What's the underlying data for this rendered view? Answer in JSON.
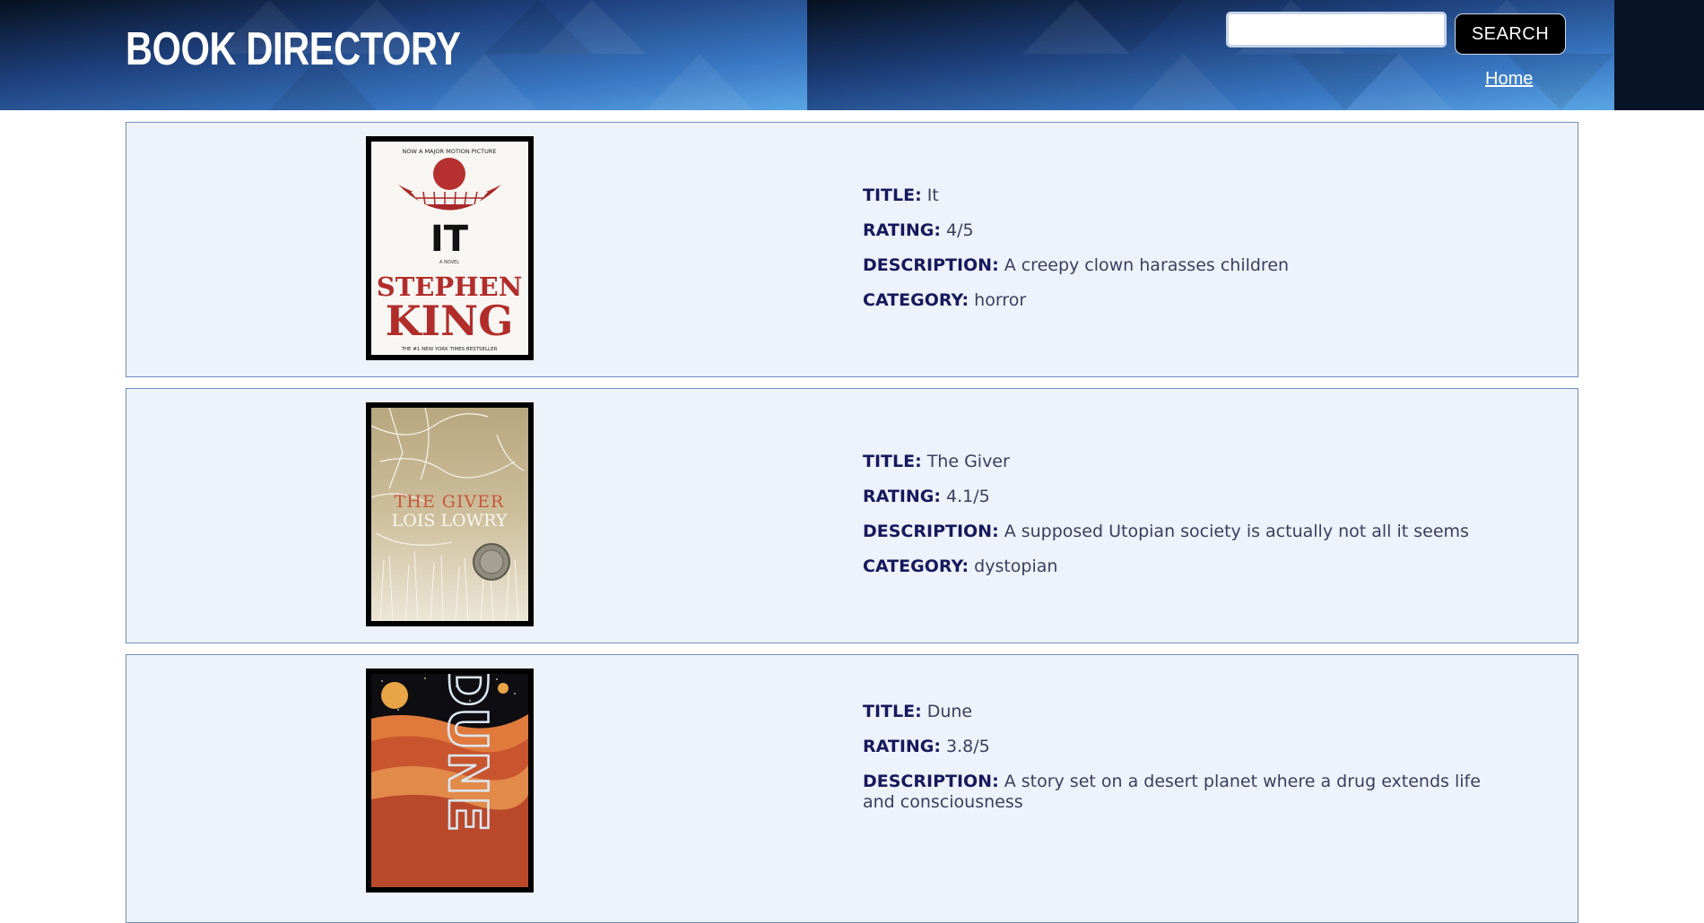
{
  "header": {
    "site_title": "BOOK DIRECTORY",
    "search": {
      "value": "",
      "placeholder": ""
    },
    "search_button_label": "SEARCH",
    "nav_home_label": "Home"
  },
  "labels": {
    "title": "TITLE:",
    "rating": "RATING:",
    "description": "DESCRIPTION:",
    "category": "CATEGORY:"
  },
  "books": [
    {
      "title": "It",
      "rating": "4/5",
      "description": "A creepy clown harasses children",
      "category": "horror",
      "cover": {
        "tagline": "NOW A MAJOR MOTION PICTURE",
        "title": "IT",
        "subtitle": "A NOVEL",
        "author_line1": "STEPHEN",
        "author_line2": "KING",
        "footer": "THE #1 NEW YORK TIMES BESTSELLER"
      }
    },
    {
      "title": "The Giver",
      "rating": "4.1/5",
      "description": "A supposed Utopian society is actually not all it seems",
      "category": "dystopian",
      "cover": {
        "title": "THE GIVER",
        "author": "LOIS LOWRY"
      }
    },
    {
      "title": "Dune",
      "rating": "3.8/5",
      "description": "A story set on a desert planet where a drug extends life and consciousness",
      "category": "",
      "cover": {
        "title": "DUNE"
      }
    }
  ],
  "colors": {
    "header_dark": "#071426",
    "header_blue": "#3f86d1",
    "card_background": "#eef2fb",
    "card_border": "#6f8fb8",
    "label_text": "#17195c",
    "value_text": "#3a3f5c"
  }
}
